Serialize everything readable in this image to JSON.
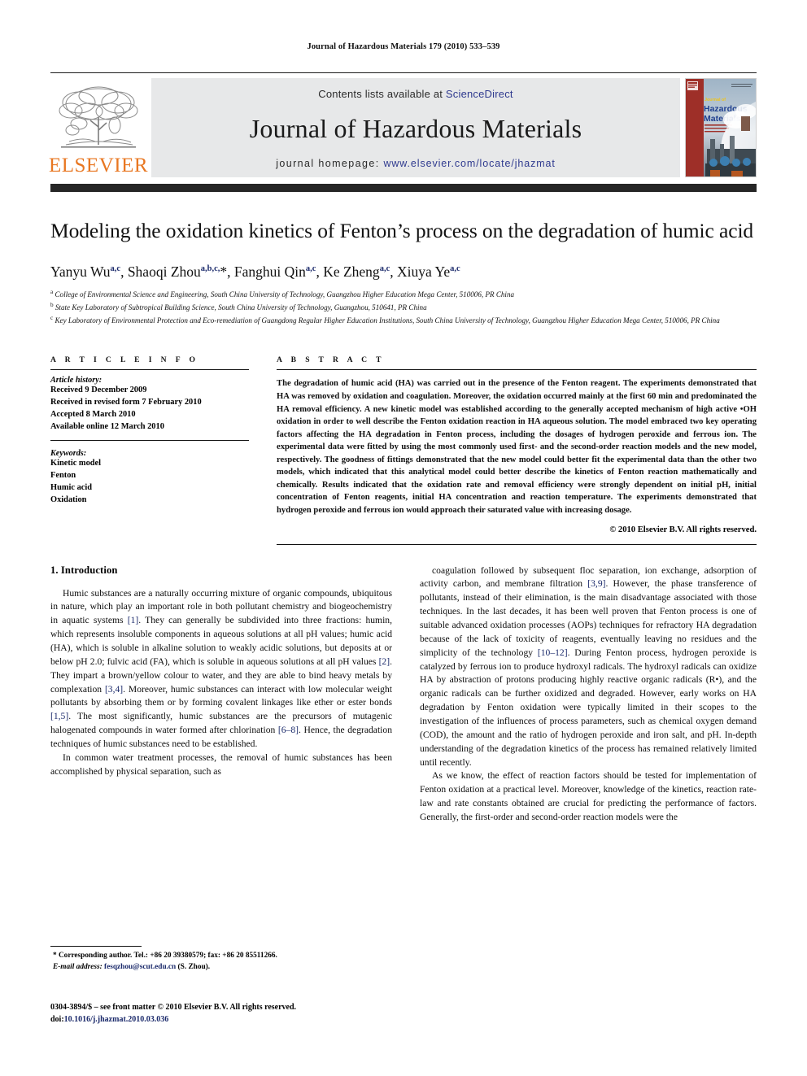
{
  "running_head": "Journal of Hazardous Materials 179 (2010) 533–539",
  "banner": {
    "contents_prefix": "Contents lists available at ",
    "sciencedirect": "ScienceDirect",
    "journal_title": "Journal of Hazardous Materials",
    "homepage_prefix": "journal homepage: ",
    "homepage_url": "www.elsevier.com/locate/jhazmat",
    "publisher_wordmark": "ELSEVIER",
    "publisher_color": "#E87722",
    "sciencedirect_color": "#2f3a8f",
    "cover_title_line1": "Journal of",
    "cover_title_line2": "Hazardous",
    "cover_title_line3": "Materials"
  },
  "article": {
    "title": "Modeling the oxidation kinetics of Fenton’s process on the degradation of humic acid",
    "authors": [
      {
        "name": "Yanyu Wu",
        "sup": "a,c",
        "corresponding": false
      },
      {
        "name": "Shaoqi Zhou",
        "sup": "a,b,c,",
        "corresponding": true
      },
      {
        "name": "Fanghui Qin",
        "sup": "a,c",
        "corresponding": false
      },
      {
        "name": "Ke Zheng",
        "sup": "a,c",
        "corresponding": false
      },
      {
        "name": "Xiuya Ye",
        "sup": "a,c",
        "corresponding": false
      }
    ],
    "affiliations": [
      {
        "marker": "a",
        "text": "College of Environmental Science and Engineering, South China University of Technology, Guangzhou Higher Education Mega Center, 510006, PR China"
      },
      {
        "marker": "b",
        "text": "State Key Laboratory of Subtropical Building Science, South China University of Technology, Guangzhou, 510641, PR China"
      },
      {
        "marker": "c",
        "text": "Key Laboratory of Environmental Protection and Eco-remediation of Guangdong Regular Higher Education Institutions, South China University of Technology, Guangzhou Higher Education Mega Center, 510006, PR China"
      }
    ]
  },
  "article_info": {
    "heading": "A R T I C L E   I N F O",
    "history_label": "Article history:",
    "history": [
      "Received 9 December 2009",
      "Received in revised form 7 February 2010",
      "Accepted 8 March 2010",
      "Available online 12 March 2010"
    ],
    "keywords_label": "Keywords:",
    "keywords": [
      "Kinetic model",
      "Fenton",
      "Humic acid",
      "Oxidation"
    ]
  },
  "abstract": {
    "heading": "A B S T R A C T",
    "text": "The degradation of humic acid (HA) was carried out in the presence of the Fenton reagent. The experiments demonstrated that HA was removed by oxidation and coagulation. Moreover, the oxidation occurred mainly at the first 60 min and predominated the HA removal efficiency. A new kinetic model was established according to the generally accepted mechanism of high active •OH oxidation in order to well describe the Fenton oxidation reaction in HA aqueous solution. The model embraced two key operating factors affecting the HA degradation in Fenton process, including the dosages of hydrogen peroxide and ferrous ion. The experimental data were fitted by using the most commonly used first- and the second-order reaction models and the new model, respectively. The goodness of fittings demonstrated that the new model could better fit the experimental data than the other two models, which indicated that this analytical model could better describe the kinetics of Fenton reaction mathematically and chemically. Results indicated that the oxidation rate and removal efficiency were strongly dependent on initial pH, initial concentration of Fenton reagents, initial HA concentration and reaction temperature. The experiments demonstrated that hydrogen peroxide and ferrous ion would approach their saturated value with increasing dosage.",
    "copyright": "© 2010 Elsevier B.V. All rights reserved."
  },
  "body": {
    "section_number_title": "1.  Introduction",
    "left_paragraphs": [
      "Humic substances are a naturally occurring mixture of organic compounds, ubiquitous in nature, which play an important role in both pollutant chemistry and biogeochemistry in aquatic systems [1]. They can generally be subdivided into three fractions: humin, which represents insoluble components in aqueous solutions at all pH values; humic acid (HA), which is soluble in alkaline solution to weakly acidic solutions, but deposits at or below pH 2.0; fulvic acid (FA), which is soluble in aqueous solutions at all pH values [2]. They impart a brown/yellow colour to water, and they are able to bind heavy metals by complexation [3,4]. Moreover, humic substances can interact with low molecular weight pollutants by absorbing them or by forming covalent linkages like ether or ester bonds [1,5]. The most significantly, humic substances are the precursors of mutagenic halogenated compounds in water formed after chlorination [6–8]. Hence, the degradation techniques of humic substances need to be established.",
      "In common water treatment processes, the removal of humic substances has been accomplished by physical separation, such as"
    ],
    "right_paragraphs": [
      "coagulation followed by subsequent floc separation, ion exchange, adsorption of activity carbon, and membrane filtration [3,9]. However, the phase transference of pollutants, instead of their elimination, is the main disadvantage associated with those techniques. In the last decades, it has been well proven that Fenton process is one of suitable advanced oxidation processes (AOPs) techniques for refractory HA degradation because of the lack of toxicity of reagents, eventually leaving no residues and the simplicity of the technology [10–12]. During Fenton process, hydrogen peroxide is catalyzed by ferrous ion to produce hydroxyl radicals. The hydroxyl radicals can oxidize HA by abstraction of protons producing highly reactive organic radicals (R•), and the organic radicals can be further oxidized and degraded. However, early works on HA degradation by Fenton oxidation were typically limited in their scopes to the investigation of the influences of process parameters, such as chemical oxygen demand (COD), the amount and the ratio of hydrogen peroxide and iron salt, and pH. In-depth understanding of the degradation kinetics of the process has remained relatively limited until recently.",
      "As we know, the effect of reaction factors should be tested for implementation of Fenton oxidation at a practical level. Moreover, knowledge of the kinetics, reaction rate-law and rate constants obtained are crucial for predicting the performance of factors. Generally, the first-order and second-order reaction models were the"
    ]
  },
  "footnotes": {
    "corresponding": "* Corresponding author. Tel.: +86 20 39380579; fax: +86 20 85511266.",
    "email_label": "E-mail address:",
    "email": "fesqzhou@scut.edu.cn",
    "email_suffix": " (S. Zhou).",
    "imprint_line": "0304-3894/$ – see front matter © 2010 Elsevier B.V. All rights reserved.",
    "doi_label": "doi:",
    "doi_value": "10.1016/j.jhazmat.2010.03.036"
  }
}
